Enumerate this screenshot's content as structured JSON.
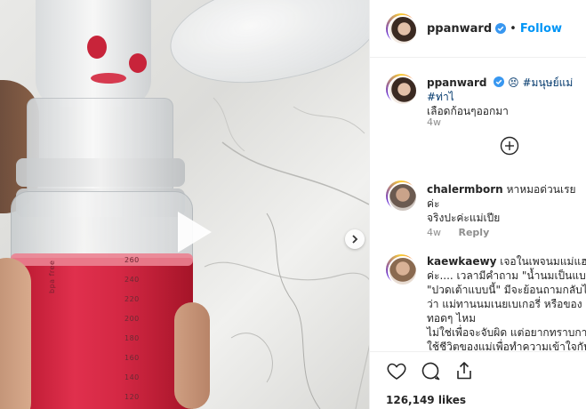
{
  "post": {
    "media_alt_icon": "play-icon",
    "next_icon": "chevron-right-icon",
    "bottle_scale": [
      "260",
      "240",
      "220",
      "200",
      "180",
      "160",
      "140",
      "120",
      "100"
    ],
    "bottle_brand_text": "bpa free"
  },
  "header": {
    "username": "ppanward",
    "follow_label": "Follow",
    "dot": "•"
  },
  "caption": {
    "username": "ppanward",
    "text": "😣 #มนุษย์แม่ #ท่าไ",
    "line2": "เลือดก้อนๆออกมา",
    "time": "4w"
  },
  "comments": [
    {
      "username": "chalermborn",
      "text": "หาหมอด่วนเรยค่ะ",
      "line2": "จริงปะค่ะแม่เปีย",
      "time": "4w",
      "reply_label": "Reply"
    },
    {
      "username": "kaewkaewy",
      "lines": [
        "เจอในเพจนมแม่แฮปปี้",
        "ค่ะ.... เวลามีคำถาม \"น้ำนมเป็นแบบนี้",
        "\"ปวดเต้าแบบนี้\" มีจะย้อนถามกลับไ",
        "ว่า แม่ทานนมเนยเบเกอรี่ หรือของ",
        "ทอดๆ ไหม",
        "ไม่ใช่เพื่อจะจับผิด แต่อยากทราบกา",
        "ใช้ชีวิตของแม่เพื่อทำความเข้าใจกับ"
      ]
    }
  ],
  "likes": {
    "count": "126,149",
    "label": "likes"
  },
  "colors": {
    "link_blue": "#0095f6",
    "verified_blue": "#3897f0",
    "text": "#262626",
    "muted": "#8e8e8e"
  }
}
